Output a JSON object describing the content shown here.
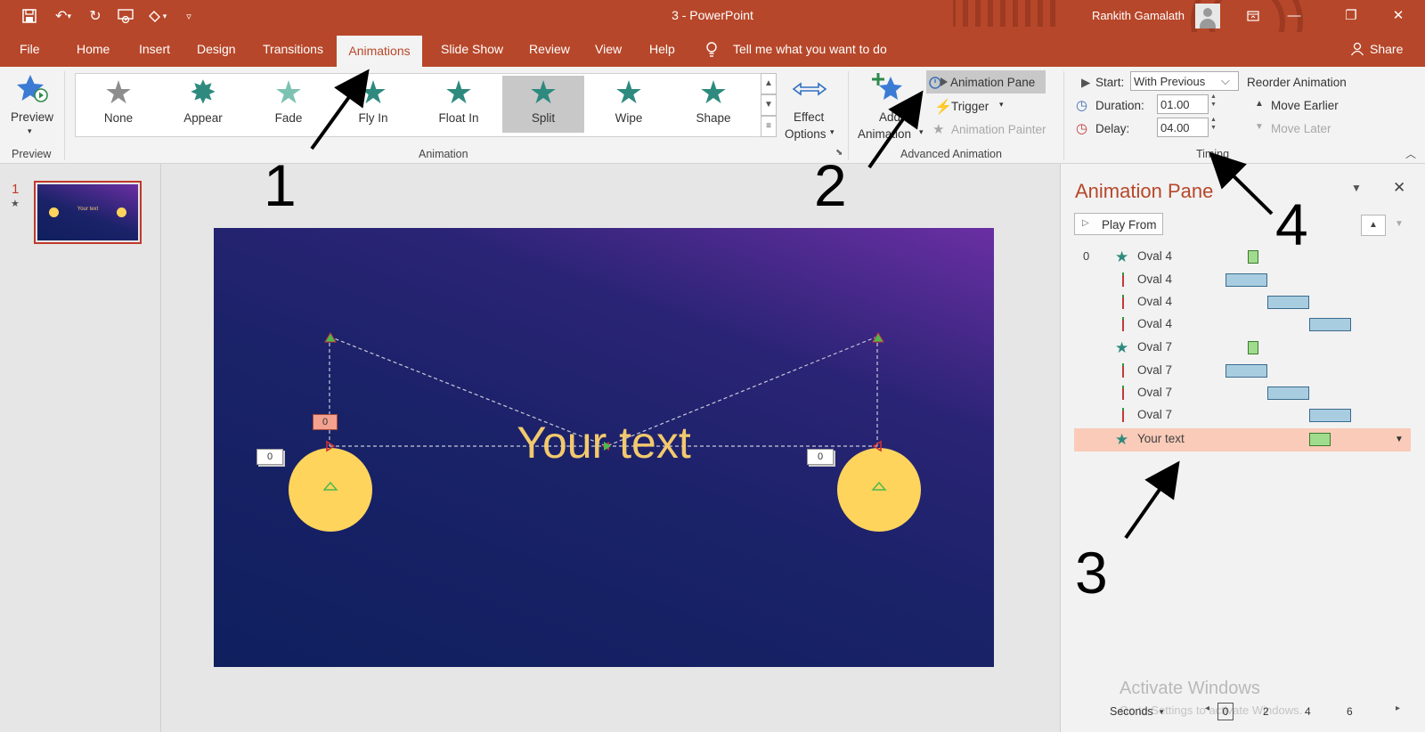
{
  "window": {
    "doc_title": "3 - PowerPoint",
    "user_name": "Rankith Gamalath",
    "share_label": "Share"
  },
  "tabs": [
    "File",
    "Home",
    "Insert",
    "Design",
    "Transitions",
    "Animations",
    "Slide Show",
    "Review",
    "View",
    "Help"
  ],
  "tell_me": "Tell me what you want to do",
  "ribbon": {
    "preview": {
      "label": "Preview",
      "group": "Preview"
    },
    "animation_gallery": {
      "group": "Animation",
      "items": [
        "None",
        "Appear",
        "Fade",
        "Fly In",
        "Float In",
        "Split",
        "Wipe",
        "Shape"
      ],
      "selected": "Split"
    },
    "effect_options": {
      "line1": "Effect",
      "line2": "Options"
    },
    "advanced": {
      "group": "Advanced Animation",
      "add_line1": "Add",
      "add_line2": "Animation",
      "animation_pane": "Animation Pane",
      "trigger": "Trigger",
      "animation_painter": "Animation Painter"
    },
    "timing": {
      "group": "Timing",
      "start_label": "Start:",
      "start_value": "With Previous",
      "duration_label": "Duration:",
      "duration_value": "01.00",
      "delay_label": "Delay:",
      "delay_value": "04.00",
      "reorder": "Reorder Animation",
      "move_earlier": "Move Earlier",
      "move_later": "Move Later"
    }
  },
  "thumbnails": {
    "slide_number": "1",
    "thumb_text": "Your text"
  },
  "slide": {
    "text": "Your text",
    "tags": [
      "0",
      "0",
      "0"
    ]
  },
  "anim_pane": {
    "title": "Animation Pane",
    "play_from": "Play From",
    "first_index": "0",
    "rows": [
      {
        "label": "Oval 4",
        "type": "star"
      },
      {
        "label": "Oval 4",
        "type": "path"
      },
      {
        "label": "Oval 4",
        "type": "path"
      },
      {
        "label": "Oval 4",
        "type": "path"
      },
      {
        "label": "Oval 7",
        "type": "star"
      },
      {
        "label": "Oval 7",
        "type": "path"
      },
      {
        "label": "Oval 7",
        "type": "path"
      },
      {
        "label": "Oval 7",
        "type": "path"
      },
      {
        "label": "Your text",
        "type": "star"
      }
    ],
    "seconds_label": "Seconds",
    "timeline_ticks": [
      "0",
      "2",
      "4",
      "6"
    ],
    "watermark_line1": "Activate Windows",
    "watermark_line2": "Go to Settings to activate Windows."
  },
  "annotations": [
    "1",
    "2",
    "3",
    "4"
  ],
  "colors": {
    "accent": "#b7472a",
    "selected_row": "#f9cbb8",
    "slide_circle": "#ffd45c",
    "slide_text": "#f2c96d"
  }
}
